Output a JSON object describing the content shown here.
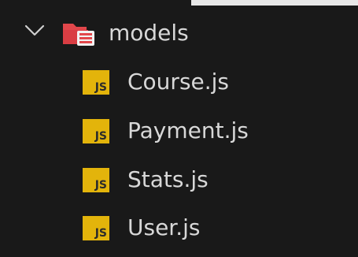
{
  "explorer": {
    "folder": {
      "name": "models",
      "expanded": true,
      "icon": "folder-open-icon",
      "icon_color": "#e2474b"
    },
    "files": [
      {
        "name": "Course.js",
        "icon": "js-file-icon",
        "badge": "JS"
      },
      {
        "name": "Payment.js",
        "icon": "js-file-icon",
        "badge": "JS"
      },
      {
        "name": "Stats.js",
        "icon": "js-file-icon",
        "badge": "JS"
      },
      {
        "name": "User.js",
        "icon": "js-file-icon",
        "badge": "JS"
      }
    ],
    "colors": {
      "background": "#191919",
      "text": "#d8d8d8",
      "js_badge": "#e3b40b"
    }
  }
}
